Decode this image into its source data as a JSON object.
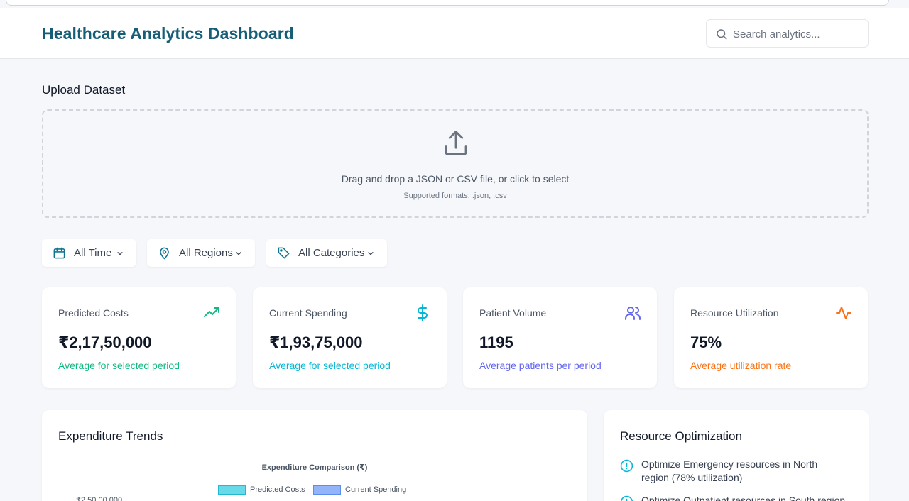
{
  "header": {
    "title": "Healthcare Analytics Dashboard",
    "search_placeholder": "Search analytics..."
  },
  "upload": {
    "section_title": "Upload Dataset",
    "prompt": "Drag and drop a JSON or CSV file, or click to select",
    "formats": "Supported formats: .json, .csv"
  },
  "filters": {
    "time": "All Time",
    "region": "All Regions",
    "category": "All Categories"
  },
  "cards": [
    {
      "title": "Predicted Costs",
      "value": "₹2,17,50,000",
      "subtitle": "Average for selected period",
      "icon": "trending-up-icon",
      "color": "#10b981"
    },
    {
      "title": "Current Spending",
      "value": "₹1,93,75,000",
      "subtitle": "Average for selected period",
      "icon": "dollar-icon",
      "color": "#06b6d4"
    },
    {
      "title": "Patient Volume",
      "value": "1195",
      "subtitle": "Average patients per period",
      "icon": "users-icon",
      "color": "#6366f1"
    },
    {
      "title": "Resource Utilization",
      "value": "75%",
      "subtitle": "Average utilization rate",
      "icon": "activity-icon",
      "color": "#f97316"
    }
  ],
  "trends": {
    "panel_title": "Expenditure Trends",
    "chart_data": {
      "type": "bar",
      "title": "Expenditure Comparison (₹)",
      "series": [
        {
          "name": "Predicted Costs",
          "color": "#67d9e8"
        },
        {
          "name": "Current Spending",
          "color": "#93b4f8"
        }
      ],
      "yticks": [
        "₹2,50,00,000"
      ]
    }
  },
  "optimization": {
    "panel_title": "Resource Optimization",
    "items": [
      "Optimize Emergency resources in North region (78% utilization)",
      "Optimize Outpatient resources in South region"
    ]
  }
}
